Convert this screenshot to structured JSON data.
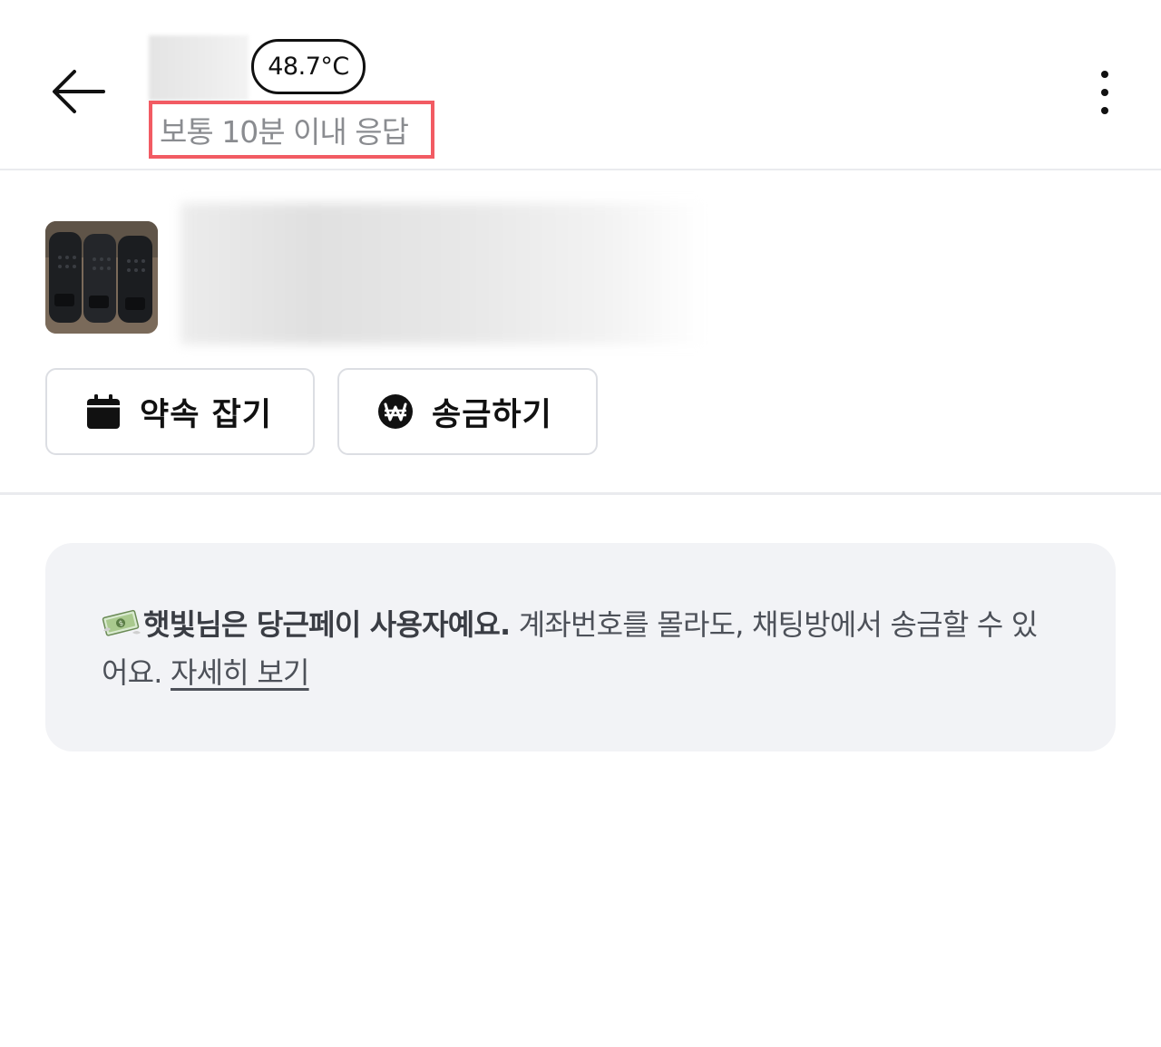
{
  "header": {
    "back_icon": "arrow-left-icon",
    "temperature": "48.7°C",
    "response_time": "보통 10분 이내 응답",
    "more_icon": "more-vertical-icon"
  },
  "product": {
    "thumbnail_alt": "product photo"
  },
  "actions": {
    "appointment_label": "약속 잡기",
    "appointment_icon": "calendar-icon",
    "send_money_label": "송금하기",
    "send_money_icon": "won-coin-icon"
  },
  "info": {
    "icon": "money-bills-icon",
    "bold_text": "햇빛님은 당근페이 사용자예요.",
    "body_text": " 계좌번호를 몰라도, 채팅방에서 송금할 수 있어요. ",
    "link_text": "자세히 보기"
  },
  "colors": {
    "highlight": "#f25b63",
    "card_bg": "#f2f3f6",
    "border": "#dcdee3"
  }
}
